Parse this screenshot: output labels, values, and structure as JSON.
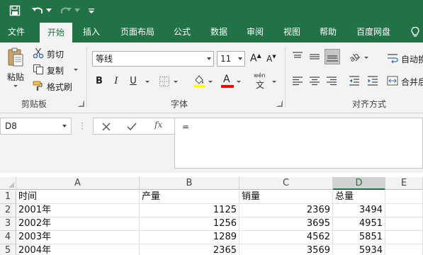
{
  "quick_access": {
    "icons": [
      "save-icon",
      "undo-icon",
      "undo-dropdown-icon",
      "redo-icon",
      "redo-dropdown-icon",
      "customize-quick-access-icon"
    ]
  },
  "tabs": [
    "文件",
    "开始",
    "插入",
    "页面布局",
    "公式",
    "数据",
    "审阅",
    "视图",
    "帮助",
    "百度网盘"
  ],
  "active_tab": "开始",
  "tell_me_icon": "lightbulb-icon",
  "ribbon": {
    "clipboard": {
      "paste": "粘贴",
      "cut": "剪切",
      "copy": "复制",
      "format_painter": "格式刷",
      "label": "剪贴板"
    },
    "font": {
      "font_name": "等线",
      "font_size": "11",
      "grow": "A",
      "shrink": "A",
      "bold": "B",
      "italic": "I",
      "underline": "U",
      "font_color_letter": "A",
      "phonetic": "wén",
      "label": "字体"
    },
    "alignment": {
      "wrap_text": "自动换",
      "merge_center": "合并后",
      "label": "对齐方式"
    }
  },
  "formula_bar": {
    "name_box": "D8",
    "formula": "="
  },
  "sheet": {
    "columns": [
      "A",
      "B",
      "C",
      "D",
      "E"
    ],
    "selected_column": "D",
    "rows": [
      {
        "num": "1",
        "cells": [
          "时间",
          "产量",
          "销量",
          "总量"
        ]
      },
      {
        "num": "2",
        "cells": [
          "2001年",
          "1125",
          "2369",
          "3494"
        ]
      },
      {
        "num": "3",
        "cells": [
          "2002年",
          "1256",
          "3695",
          "4951"
        ]
      },
      {
        "num": "4",
        "cells": [
          "2003年",
          "1289",
          "4562",
          "5851"
        ]
      },
      {
        "num": "5",
        "cells": [
          "2004年",
          "2365",
          "3569",
          "5934"
        ]
      }
    ]
  },
  "colors": {
    "brand": "#217346",
    "ribbon_bg": "#f3f3f3",
    "highlight_yellow": "#ffff00",
    "font_red": "#ff0000"
  }
}
